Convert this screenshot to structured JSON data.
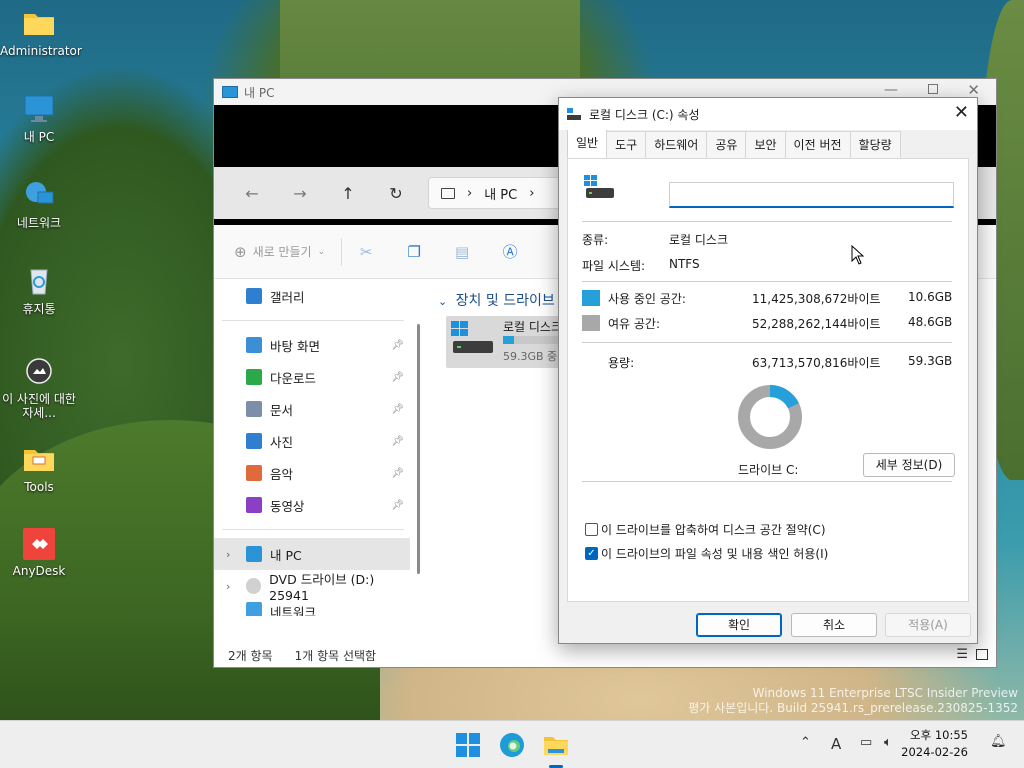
{
  "desktop": {
    "icons": [
      {
        "label": "Administrator"
      },
      {
        "label": "내 PC"
      },
      {
        "label": "네트워크"
      },
      {
        "label": "휴지통"
      },
      {
        "label": "이 사진에 대한 자세..."
      },
      {
        "label": "Tools"
      },
      {
        "label": "AnyDesk"
      }
    ],
    "watermark_line1": "Windows 11 Enterprise LTSC Insider Preview",
    "watermark_line2": "평가 사본입니다. Build 25941.rs_prerelease.230825-1352"
  },
  "explorer": {
    "title": "내 PC",
    "address_path": "내 PC",
    "new_button": "새로 만들기",
    "sidebar": {
      "gallery": "갤러리",
      "quick": [
        {
          "label": "바탕 화면",
          "color": "#3a8fd6"
        },
        {
          "label": "다운로드",
          "color": "#2aa84a"
        },
        {
          "label": "문서",
          "color": "#7d8fa8"
        },
        {
          "label": "사진",
          "color": "#2f7fd0"
        },
        {
          "label": "음악",
          "color": "#e06a3c"
        },
        {
          "label": "동영상",
          "color": "#8a3fc4"
        }
      ],
      "this_pc": "내 PC",
      "dvd": "DVD 드라이브 (D:) 25941",
      "network": "네트워크"
    },
    "group_header": "장치 및 드라이브",
    "drive_tile": {
      "name": "로컬 디스크",
      "free": "59.3GB 중"
    },
    "status": {
      "items": "2개 항목",
      "selected": "1개 항목 선택함"
    }
  },
  "dialog": {
    "title": "로컬 디스크 (C:) 속성",
    "tabs": [
      "일반",
      "도구",
      "하드웨어",
      "공유",
      "보안",
      "이전 버전",
      "할당량"
    ],
    "name_value": "",
    "type_label": "종류:",
    "type_value": "로컬 디스크",
    "fs_label": "파일 시스템:",
    "fs_value": "NTFS",
    "used": {
      "label": "사용 중인 공간:",
      "bytes": "11,425,308,672바이트",
      "size": "10.6GB",
      "color": "#26a0da"
    },
    "free": {
      "label": "여유 공간:",
      "bytes": "52,288,262,144바이트",
      "size": "48.6GB",
      "color": "#a8a8a8"
    },
    "capacity": {
      "label": "용량:",
      "bytes": "63,713,570,816바이트",
      "size": "59.3GB"
    },
    "used_fraction": 0.179,
    "drive_label": "드라이브 C:",
    "details_button": "세부 정보(D)",
    "compress_label": "이 드라이브를 압축하여 디스크 공간 절약(C)",
    "compress_checked": false,
    "index_label": "이 드라이브의 파일 속성 및 내용 색인 허용(I)",
    "index_checked": true,
    "ok": "확인",
    "cancel": "취소",
    "apply": "적용(A)"
  },
  "taskbar": {
    "ime": "A",
    "time": "오후 10:55",
    "date": "2024-02-26"
  }
}
